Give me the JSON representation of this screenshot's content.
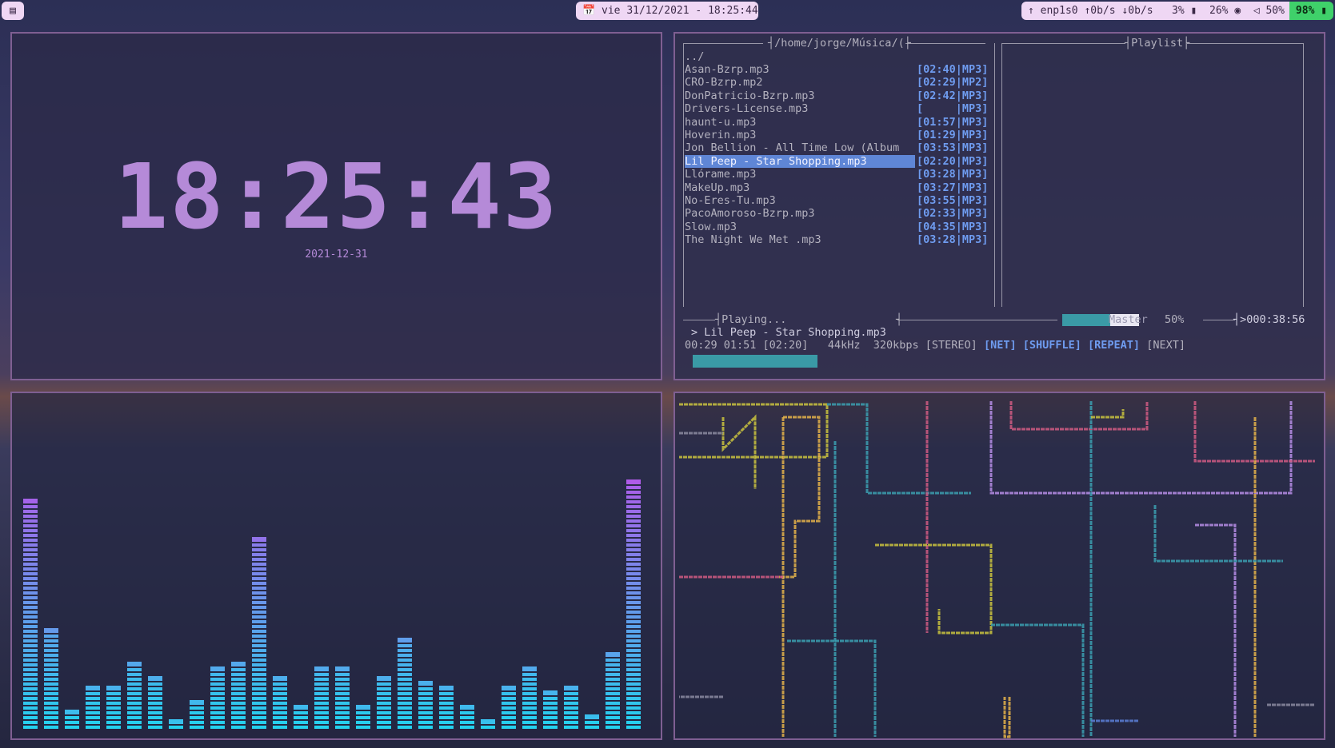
{
  "topbar": {
    "workspace_icon": "terminal-icon",
    "calendar_icon": "calendar-icon",
    "datetime": "vie 31/12/2021 - 18:25:44",
    "net_icon": "network-icon",
    "net_iface": "enp1s0",
    "up_rate": "0b/s",
    "down_rate": "0b/s",
    "cpu": "3%",
    "ram": "26%",
    "volume_icon": "speaker-icon",
    "volume": "50%",
    "battery": "98%",
    "accent": "#3fd06a"
  },
  "clock": {
    "time": "18:25:43",
    "date": "2021-12-31",
    "color": "#b58ad8"
  },
  "player": {
    "browser_path": "/home/jorge/Música/",
    "playlist_title": "Playlist",
    "parent_dir": "../",
    "files": [
      {
        "name": "Asan-Bzrp.mp3",
        "dur": "[02:40|MP3]"
      },
      {
        "name": "CRO-Bzrp.mp2",
        "dur": "[02:29|MP2]"
      },
      {
        "name": "DonPatricio-Bzrp.mp3",
        "dur": "[02:42|MP3]"
      },
      {
        "name": "Drivers-License.mp3",
        "dur": "[     |MP3]"
      },
      {
        "name": "haunt-u.mp3",
        "dur": "[01:57|MP3]"
      },
      {
        "name": "Hoverin.mp3",
        "dur": "[01:29|MP3]"
      },
      {
        "name": "Jon Bellion - All Time Low (Album",
        "dur": "[03:53|MP3]"
      },
      {
        "name": "Lil Peep - Star Shopping.mp3",
        "dur": "[02:20|MP3]"
      },
      {
        "name": "Llórame.mp3",
        "dur": "[03:28|MP3]"
      },
      {
        "name": "MakeUp.mp3",
        "dur": "[03:27|MP3]"
      },
      {
        "name": "No-Eres-Tu.mp3",
        "dur": "[03:55|MP3]"
      },
      {
        "name": "PacoAmoroso-Bzrp.mp3",
        "dur": "[02:33|MP3]"
      },
      {
        "name": "Slow.mp3",
        "dur": "[04:35|MP3]"
      },
      {
        "name": "The Night We Met .mp3",
        "dur": "[03:28|MP3]"
      }
    ],
    "status": "Playing...",
    "master_label": "Master",
    "master_volume": "50%",
    "total_time": ">000:38:56",
    "now_playing": "> Lil Peep - Star Shopping.mp3",
    "time_info": "00:29 01:51 [02:20]",
    "rate": "44kHz",
    "bitrate": "320kbps",
    "flag_stereo": "[STEREO]",
    "flag_net": "[NET]",
    "flag_shuffle": "[SHUFFLE]",
    "flag_repeat": "[REPEAT]",
    "flag_next": "[NEXT]",
    "progress": 0.21,
    "volume_fraction": 0.5
  },
  "visualizer": {
    "levels": [
      0.71,
      0.3,
      0.05,
      0.13,
      0.12,
      0.2,
      0.15,
      0.02,
      0.08,
      0.18,
      0.2,
      0.59,
      0.16,
      0.06,
      0.19,
      0.19,
      0.06,
      0.16,
      0.27,
      0.14,
      0.13,
      0.06,
      0.02,
      0.12,
      0.19,
      0.11,
      0.12,
      0.04,
      0.23,
      0.77
    ],
    "color_low": "#24d1ee",
    "color_high": "#d43be7"
  },
  "pipes": {
    "colors": [
      "#c9c23e",
      "#e3b24a",
      "#3b9fb0",
      "#d05a82",
      "#b68de6",
      "#8b8ba0",
      "#5b7fd6"
    ]
  }
}
